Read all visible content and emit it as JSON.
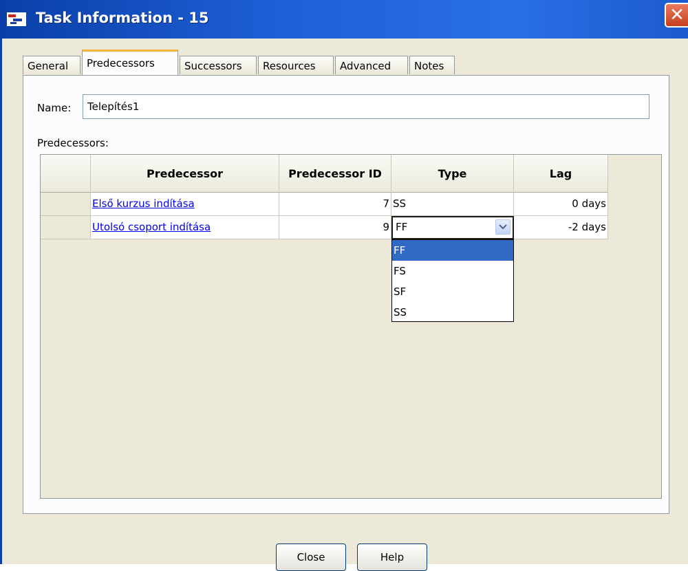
{
  "window": {
    "title": "Task Information - 15",
    "close_glyph": "✕"
  },
  "tabs": [
    {
      "label": "General"
    },
    {
      "label": "Predecessors"
    },
    {
      "label": "Successors"
    },
    {
      "label": "Resources"
    },
    {
      "label": "Advanced"
    },
    {
      "label": "Notes"
    }
  ],
  "active_tab": "Predecessors",
  "name": {
    "label": "Name:",
    "value": "Telepítés1"
  },
  "predecessors": {
    "label": "Predecessors:",
    "columns": [
      "Predecessor",
      "Predecessor ID",
      "Type",
      "Lag"
    ],
    "rows": [
      {
        "predecessor": "Első kurzus indítása",
        "id": "7",
        "type": "SS",
        "lag": "0 days"
      },
      {
        "predecessor": "Utolsó csoport indítása",
        "id": "9",
        "type": "FF",
        "lag": "-2 days"
      }
    ]
  },
  "type_dropdown": {
    "selected": "FF",
    "options": [
      "FF",
      "FS",
      "SF",
      "SS"
    ],
    "highlighted": "FF"
  },
  "buttons": {
    "close": "Close",
    "help": "Help"
  },
  "colors": {
    "title_bar": "#1e5fd6",
    "selection": "#316ac5",
    "active_tab_accent": "#f8b33a",
    "link": "#0000ee"
  }
}
